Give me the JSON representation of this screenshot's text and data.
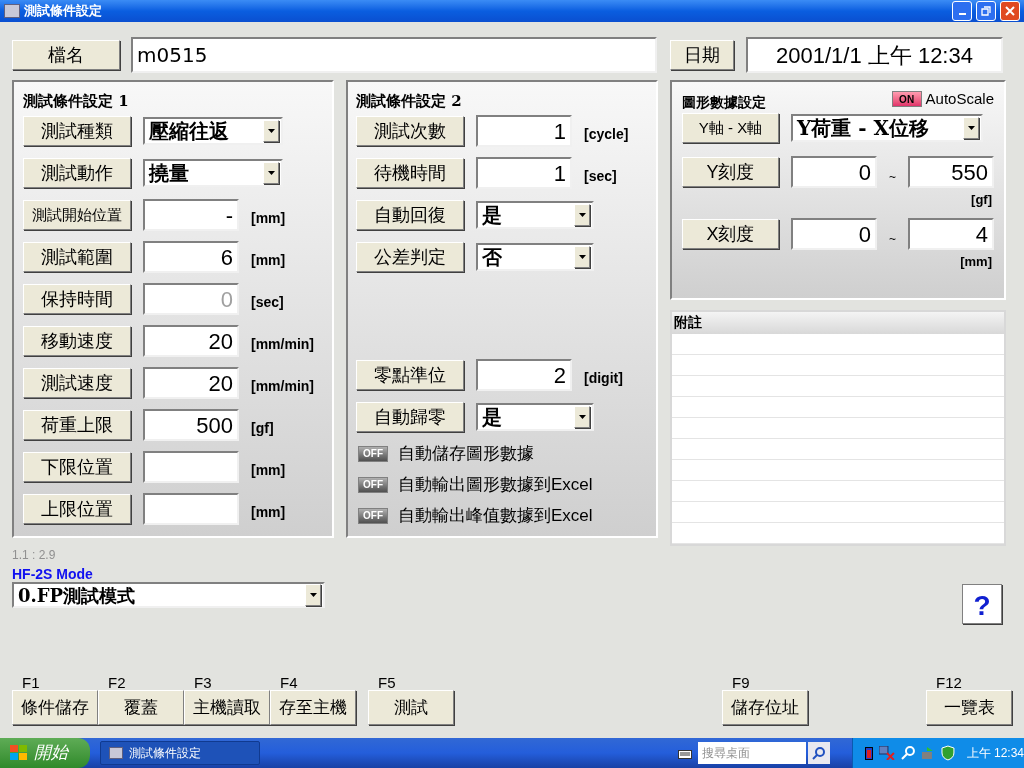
{
  "window": {
    "title": "測試條件設定"
  },
  "file": {
    "label": "檔名",
    "value": "m0515"
  },
  "date": {
    "label": "日期",
    "value": "2001/1/1 上午 12:34"
  },
  "panel1": {
    "title": "測試條件設定 1",
    "rows": [
      {
        "kind": "select",
        "label": "測試種類",
        "value": "壓縮往返"
      },
      {
        "kind": "select",
        "label": "測試動作",
        "value": "撓量"
      },
      {
        "kind": "field",
        "label": "測試開始位置",
        "value": "-",
        "unit": "[mm]",
        "disabled": false
      },
      {
        "kind": "field",
        "label": "測試範圍",
        "value": "6",
        "unit": "[mm]",
        "disabled": false
      },
      {
        "kind": "field",
        "label": "保持時間",
        "value": "0",
        "unit": "[sec]",
        "disabled": true
      },
      {
        "kind": "field",
        "label": "移動速度",
        "value": "20",
        "unit": "[mm/min]",
        "disabled": false
      },
      {
        "kind": "field",
        "label": "測試速度",
        "value": "20",
        "unit": "[mm/min]",
        "disabled": false
      },
      {
        "kind": "field",
        "label": "荷重上限",
        "value": "500",
        "unit": "[gf]",
        "disabled": false
      },
      {
        "kind": "field",
        "label": "下限位置",
        "unit": "[mm]"
      },
      {
        "kind": "field",
        "label": "上限位置",
        "unit": "[mm]"
      }
    ]
  },
  "panel2": {
    "title": "測試條件設定 2",
    "rows": [
      {
        "kind": "field",
        "label": "測試次數",
        "value": "1",
        "unit": "[cycle]",
        "disabled": false
      },
      {
        "kind": "field",
        "label": "待機時間",
        "value": "1",
        "unit": "[sec]",
        "disabled": false
      },
      {
        "kind": "select",
        "label": "自動回復",
        "value": "是"
      },
      {
        "kind": "select",
        "label": "公差判定",
        "value": "否"
      }
    ],
    "rows_lower": [
      {
        "kind": "field",
        "label": "零點準位",
        "value": "2",
        "unit": "[digit]",
        "disabled": false
      },
      {
        "kind": "select",
        "label": "自動歸零",
        "value": "是"
      }
    ],
    "toggles": [
      {
        "text": "OFF",
        "label": "自動儲存圖形數據",
        "on": false
      },
      {
        "text": "OFF",
        "label": "自動輸出圖形數據到Excel",
        "on": false
      },
      {
        "text": "OFF",
        "label": "自動輸出峰值數據到Excel",
        "on": false
      }
    ]
  },
  "graph": {
    "title": "圖形數據設定",
    "autoscale": {
      "text": "ON",
      "label": "AutoScale",
      "on": true
    },
    "axis": {
      "label": "Y軸 - X軸",
      "value": "Y荷重 - X位移"
    },
    "scales": [
      {
        "label": "Y刻度",
        "min": "0",
        "separator": "~",
        "max": "550",
        "unit": "[gf]"
      },
      {
        "label": "X刻度",
        "min": "0",
        "separator": "~",
        "max": "4",
        "unit": "[mm]"
      }
    ]
  },
  "notes": {
    "title": "附註"
  },
  "version": "1.1 : 2.9",
  "mode": {
    "label": "HF-2S Mode",
    "value": "0.FP測試模式"
  },
  "help": "?",
  "function_keys": [
    {
      "keys": [
        {
          "key": "F1",
          "label": "條件儲存"
        },
        {
          "key": "F2",
          "label": "覆蓋"
        },
        {
          "key": "F3",
          "label": "主機讀取"
        },
        {
          "key": "F4",
          "label": "存至主機"
        }
      ]
    },
    {
      "keys": [
        {
          "key": "F5",
          "label": "測試"
        }
      ]
    },
    {
      "keys": [
        {
          "key": "F9",
          "label": "儲存位址"
        }
      ]
    },
    {
      "keys": [
        {
          "key": "F12",
          "label": "一覽表"
        }
      ]
    }
  ],
  "taskbar": {
    "start": "開始",
    "task": "測試條件設定",
    "search_placeholder": "搜尋桌面",
    "clock": "上午 12:34"
  }
}
